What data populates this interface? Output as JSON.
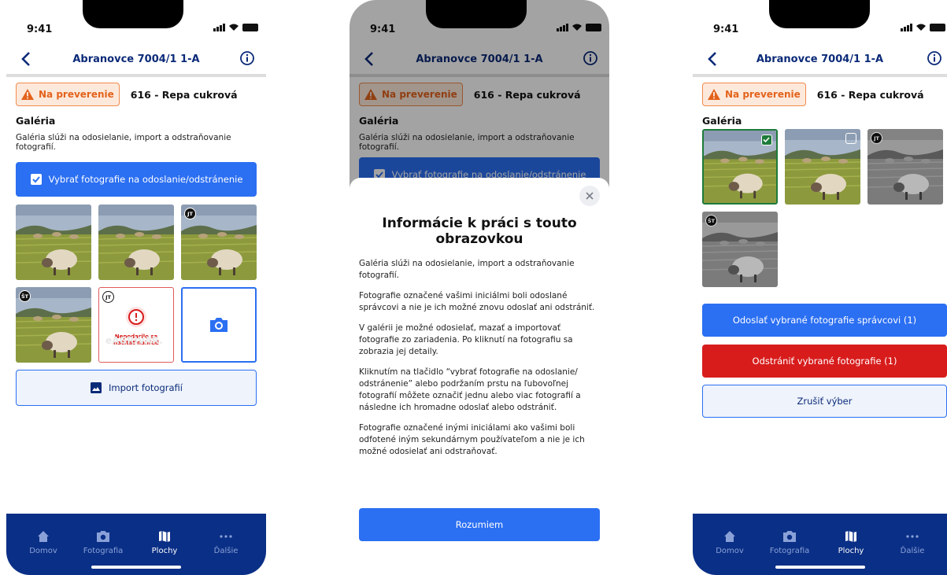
{
  "status": {
    "time": "9:41"
  },
  "nav": {
    "title": "Abranovce 7004/1 1-A"
  },
  "badge": {
    "label": "Na preverenie"
  },
  "crop": "616 - Repa cukrová",
  "gallery": {
    "title": "Galéria",
    "description": "Galéria slúži na odosielanie, import a odstraňovanie fotografií."
  },
  "select_button": "Vybrať fotografie na odoslanie/odstránenie",
  "tiles": {
    "initials_jt": "JT",
    "initials_st": "ŠT",
    "error_text": "Nepodarilo sa načítať náhľad",
    "watermark": "eAGRIVAR."
  },
  "import_button": "Import fotografií",
  "tabs": [
    {
      "label": "Domov",
      "icon": "home-icon"
    },
    {
      "label": "Fotografia",
      "icon": "camera-icon"
    },
    {
      "label": "Plochy",
      "icon": "map-icon"
    },
    {
      "label": "Ďalšie",
      "icon": "more-icon"
    }
  ],
  "modal": {
    "title": "Informácie k práci s touto obrazovkou",
    "paragraphs": [
      "Galéria slúži na odosielanie, import a odstraňovanie fotografií.",
      "Fotografie označené vašimi iniciálmi boli odoslané správcovi a nie je ich možné znovu odoslať ani odstrániť.",
      "V galérii je možné odosielať, mazať a importovať fotografie zo zariadenia.  Po kliknutí na fotografiu sa zobrazia jej detaily.",
      "Kliknutím na tlačidlo “vybrať fotografie na odoslanie/ odstránenie” alebo podržaním prstu na ľubovoľnej fotografií môžete označiť jednu alebo viac fotografií a následne ich hromadne odoslať alebo odstrániť.",
      "Fotografie označené inými iniciálami ako vašimi boli odfotené iným sekundárnym používateľom a nie je ich možné odosielať ani odstraňovať."
    ],
    "ok_button": "Rozumiem"
  },
  "actions": {
    "send": "Odoslať vybrané fotografie správcovi (1)",
    "delete": "Odstrániť vybrané fotografie (1)",
    "cancel": "Zrušiť výber"
  },
  "colors": {
    "primary": "#2b6ff2",
    "navy": "#0a2f86",
    "warning": "#e3631c",
    "danger": "#d81c1c",
    "selected": "#1e7b3a"
  }
}
